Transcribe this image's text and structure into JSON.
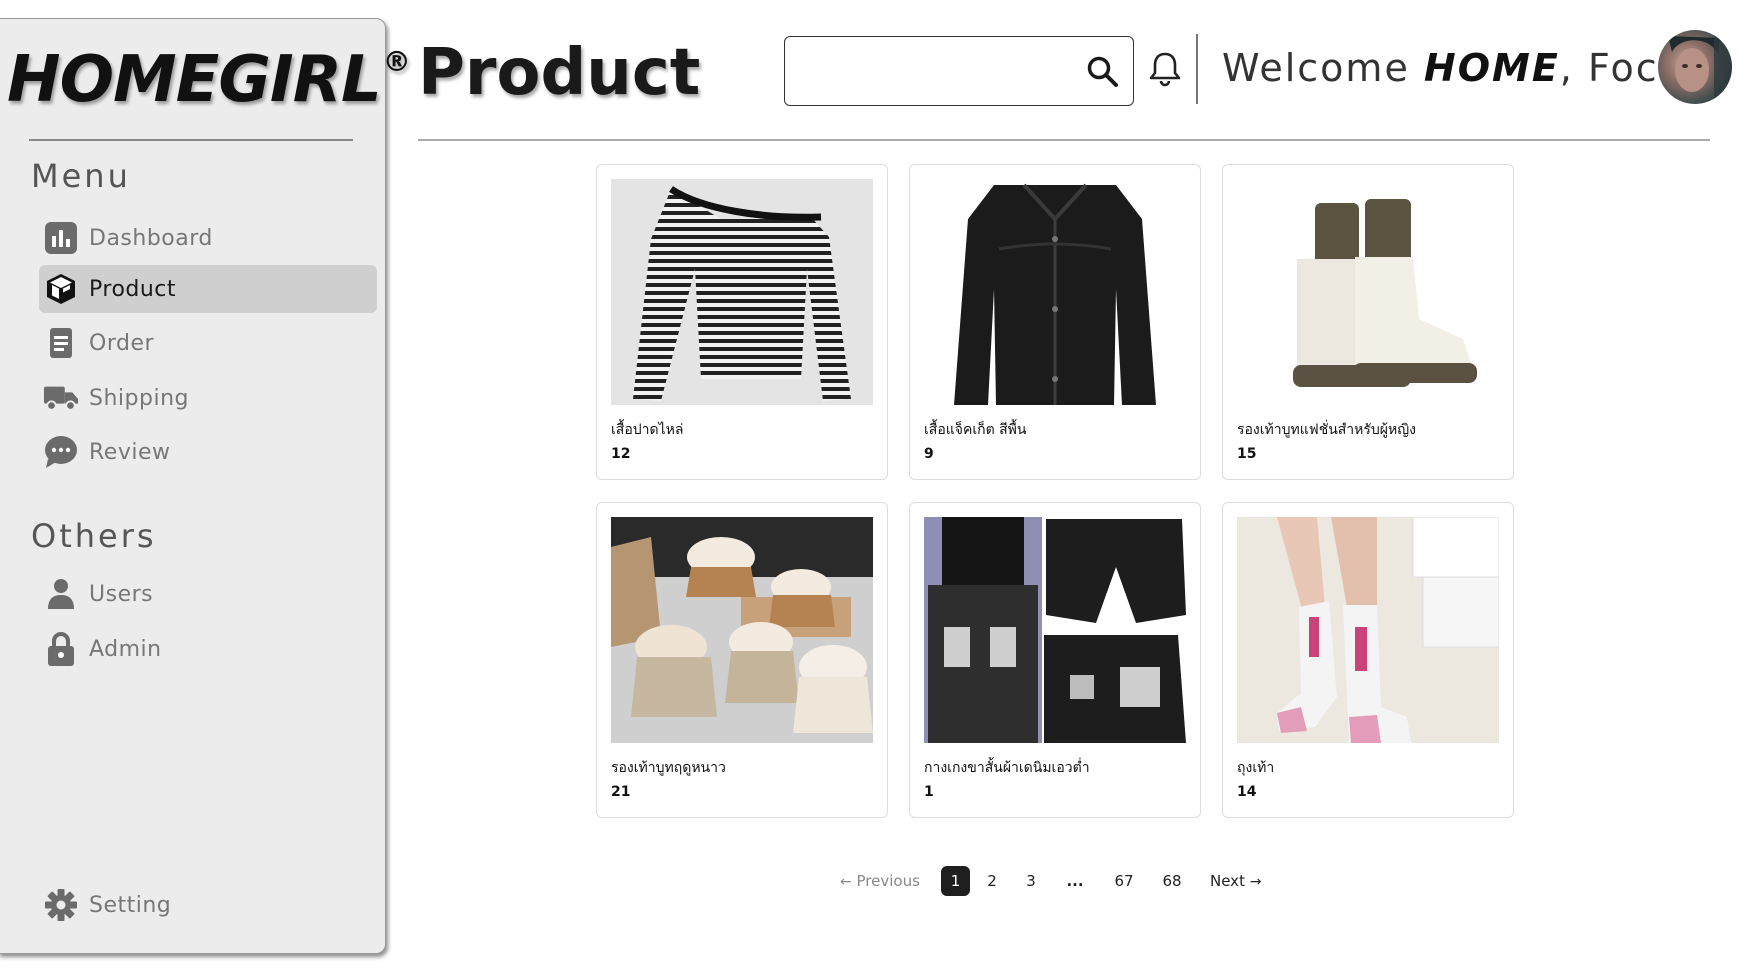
{
  "sidebar": {
    "brand": "HOMEGIRL",
    "brand_mark": "®",
    "menu_title": "Menu",
    "menu_items": [
      {
        "label": "Dashboard",
        "icon": "bar-chart-icon"
      },
      {
        "label": "Product",
        "icon": "box-icon",
        "active": true
      },
      {
        "label": "Order",
        "icon": "document-icon"
      },
      {
        "label": "Shipping",
        "icon": "truck-icon"
      },
      {
        "label": "Review",
        "icon": "chat-bubble-icon"
      }
    ],
    "others_title": "Others",
    "other_items": [
      {
        "label": "Users",
        "icon": "user-icon"
      },
      {
        "label": "Admin",
        "icon": "lock-icon"
      }
    ],
    "setting_label": "Setting"
  },
  "header": {
    "title": "Product",
    "search": {
      "value": "",
      "placeholder": ""
    },
    "welcome_prefix": "Welcome ",
    "welcome_brand": "HOME",
    "welcome_suffix": ", Focus"
  },
  "products": [
    {
      "name": "เสื้อปาดไหล่",
      "qty": "12"
    },
    {
      "name": "เสื้อแจ็คเก็ต สีพื้น",
      "qty": "9"
    },
    {
      "name": "รองเท้าบูทแฟชั่นสำหรับผู้หญิง",
      "qty": "15"
    },
    {
      "name": "รองเท้าบูทฤดูหนาว",
      "qty": "21"
    },
    {
      "name": "กางเกงขาสั้นผ้าเดนิมเอวต่ำ",
      "qty": "1"
    },
    {
      "name": "ถุงเท้า",
      "qty": "14"
    }
  ],
  "pagination": {
    "previous": "Previous",
    "pages": [
      "1",
      "2",
      "3",
      "...",
      "67",
      "68"
    ],
    "current": "1",
    "next": "Next"
  },
  "colors": {
    "sidebar_bg": "#ececec",
    "active_item_bg": "#cfcfcf",
    "pager_active": "#1f1f1f"
  }
}
